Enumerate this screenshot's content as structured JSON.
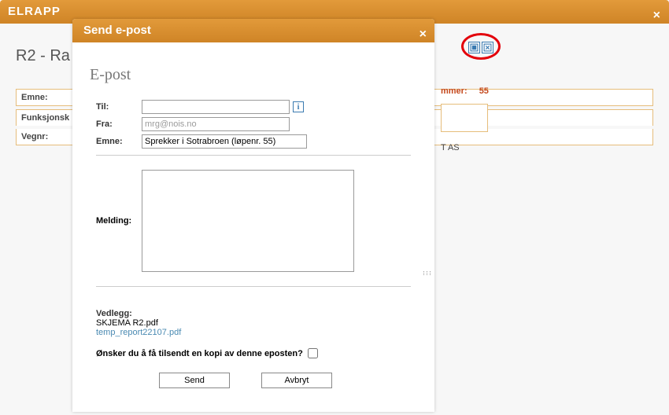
{
  "outer": {
    "title": "ELRAPP",
    "close_glyph": "×"
  },
  "page": {
    "title_visible": "R2 - Ra"
  },
  "bg_fields": {
    "emne": "Emne:",
    "funksjonsk": "Funksjonsk",
    "vegnr": "Vegnr:"
  },
  "right": {
    "mmer_label": "mmer:",
    "mmer_value": "55",
    "as_text": "T AS"
  },
  "modal": {
    "header": "Send e-post",
    "close_glyph": "×",
    "heading": "E-post",
    "til_label": "Til:",
    "til_value": "",
    "fra_label": "Fra:",
    "fra_value": "mrg@nois.no",
    "emne_label": "Emne:",
    "emne_value": "Sprekker i Sotrabroen (løpenr. 55)",
    "melding_label": "Melding:",
    "melding_value": "",
    "vedlegg_label": "Vedlegg:",
    "attachment1": "SKJEMA R2.pdf",
    "attachment2": "temp_report22107.pdf",
    "copy_question": "Ønsker du å få tilsendt en kopi av denne eposten?",
    "send_label": "Send",
    "cancel_label": "Avbryt",
    "info_glyph": "i"
  }
}
